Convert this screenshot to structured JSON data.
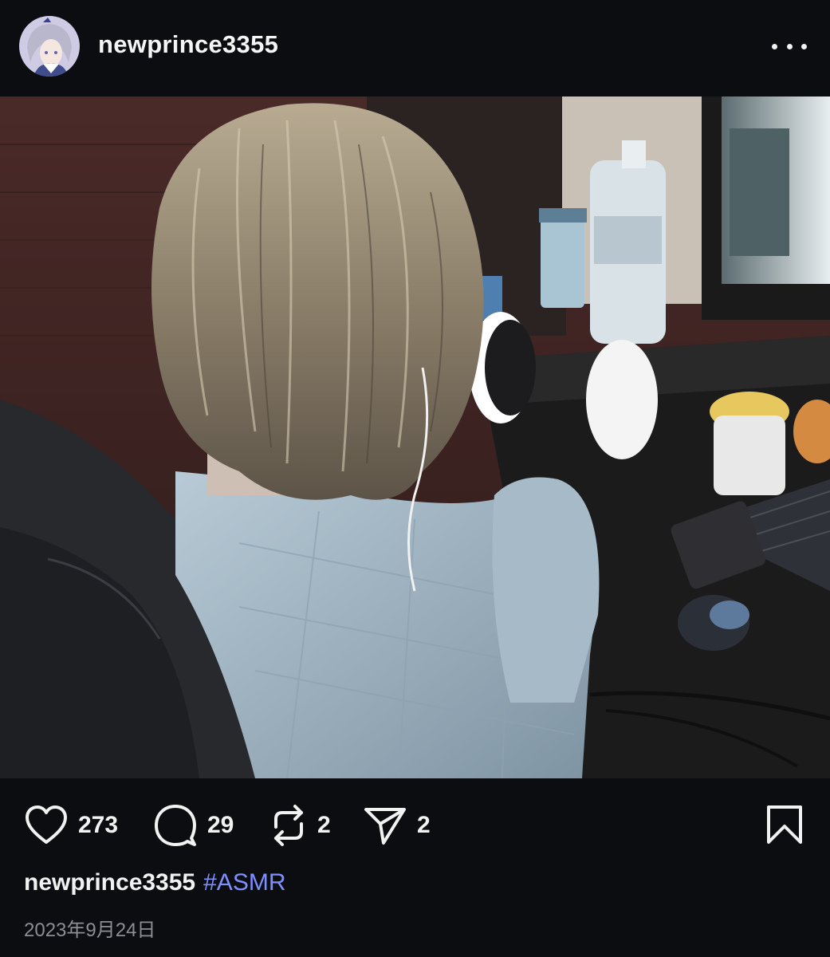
{
  "post": {
    "username": "newprince3355",
    "hashtag": "#ASMR",
    "date": "2023年9月24日",
    "photo_description_icon": "photo"
  },
  "header": {
    "more_icon": "more-horizontal-icon"
  },
  "actions": {
    "likes": "273",
    "comments": "29",
    "reposts": "2",
    "shares": "2"
  },
  "colors": {
    "background": "#0b0d11",
    "hashtag": "#7f8fff",
    "date": "#8b8e94"
  }
}
